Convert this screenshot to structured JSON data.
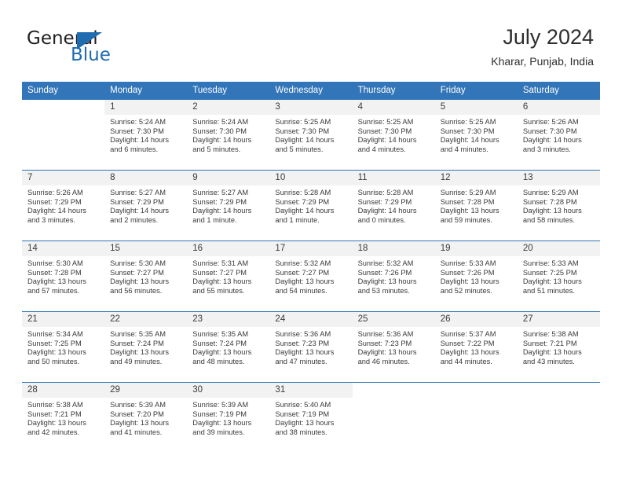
{
  "brand": {
    "name_part1": "General",
    "name_part2": "Blue",
    "logo_icon": "triangle-flag-icon",
    "accent_color": "#1f6cb0"
  },
  "header": {
    "title": "July 2024",
    "location": "Kharar, Punjab, India"
  },
  "calendar": {
    "header_bg": "#3275b9",
    "weekday_headers": [
      "Sunday",
      "Monday",
      "Tuesday",
      "Wednesday",
      "Thursday",
      "Friday",
      "Saturday"
    ],
    "weeks": [
      [
        {
          "day": "",
          "sunrise": "",
          "sunset": "",
          "daylight1": "",
          "daylight2": ""
        },
        {
          "day": "1",
          "sunrise": "Sunrise: 5:24 AM",
          "sunset": "Sunset: 7:30 PM",
          "daylight1": "Daylight: 14 hours",
          "daylight2": "and 6 minutes."
        },
        {
          "day": "2",
          "sunrise": "Sunrise: 5:24 AM",
          "sunset": "Sunset: 7:30 PM",
          "daylight1": "Daylight: 14 hours",
          "daylight2": "and 5 minutes."
        },
        {
          "day": "3",
          "sunrise": "Sunrise: 5:25 AM",
          "sunset": "Sunset: 7:30 PM",
          "daylight1": "Daylight: 14 hours",
          "daylight2": "and 5 minutes."
        },
        {
          "day": "4",
          "sunrise": "Sunrise: 5:25 AM",
          "sunset": "Sunset: 7:30 PM",
          "daylight1": "Daylight: 14 hours",
          "daylight2": "and 4 minutes."
        },
        {
          "day": "5",
          "sunrise": "Sunrise: 5:25 AM",
          "sunset": "Sunset: 7:30 PM",
          "daylight1": "Daylight: 14 hours",
          "daylight2": "and 4 minutes."
        },
        {
          "day": "6",
          "sunrise": "Sunrise: 5:26 AM",
          "sunset": "Sunset: 7:30 PM",
          "daylight1": "Daylight: 14 hours",
          "daylight2": "and 3 minutes."
        }
      ],
      [
        {
          "day": "7",
          "sunrise": "Sunrise: 5:26 AM",
          "sunset": "Sunset: 7:29 PM",
          "daylight1": "Daylight: 14 hours",
          "daylight2": "and 3 minutes."
        },
        {
          "day": "8",
          "sunrise": "Sunrise: 5:27 AM",
          "sunset": "Sunset: 7:29 PM",
          "daylight1": "Daylight: 14 hours",
          "daylight2": "and 2 minutes."
        },
        {
          "day": "9",
          "sunrise": "Sunrise: 5:27 AM",
          "sunset": "Sunset: 7:29 PM",
          "daylight1": "Daylight: 14 hours",
          "daylight2": "and 1 minute."
        },
        {
          "day": "10",
          "sunrise": "Sunrise: 5:28 AM",
          "sunset": "Sunset: 7:29 PM",
          "daylight1": "Daylight: 14 hours",
          "daylight2": "and 1 minute."
        },
        {
          "day": "11",
          "sunrise": "Sunrise: 5:28 AM",
          "sunset": "Sunset: 7:29 PM",
          "daylight1": "Daylight: 14 hours",
          "daylight2": "and 0 minutes."
        },
        {
          "day": "12",
          "sunrise": "Sunrise: 5:29 AM",
          "sunset": "Sunset: 7:28 PM",
          "daylight1": "Daylight: 13 hours",
          "daylight2": "and 59 minutes."
        },
        {
          "day": "13",
          "sunrise": "Sunrise: 5:29 AM",
          "sunset": "Sunset: 7:28 PM",
          "daylight1": "Daylight: 13 hours",
          "daylight2": "and 58 minutes."
        }
      ],
      [
        {
          "day": "14",
          "sunrise": "Sunrise: 5:30 AM",
          "sunset": "Sunset: 7:28 PM",
          "daylight1": "Daylight: 13 hours",
          "daylight2": "and 57 minutes."
        },
        {
          "day": "15",
          "sunrise": "Sunrise: 5:30 AM",
          "sunset": "Sunset: 7:27 PM",
          "daylight1": "Daylight: 13 hours",
          "daylight2": "and 56 minutes."
        },
        {
          "day": "16",
          "sunrise": "Sunrise: 5:31 AM",
          "sunset": "Sunset: 7:27 PM",
          "daylight1": "Daylight: 13 hours",
          "daylight2": "and 55 minutes."
        },
        {
          "day": "17",
          "sunrise": "Sunrise: 5:32 AM",
          "sunset": "Sunset: 7:27 PM",
          "daylight1": "Daylight: 13 hours",
          "daylight2": "and 54 minutes."
        },
        {
          "day": "18",
          "sunrise": "Sunrise: 5:32 AM",
          "sunset": "Sunset: 7:26 PM",
          "daylight1": "Daylight: 13 hours",
          "daylight2": "and 53 minutes."
        },
        {
          "day": "19",
          "sunrise": "Sunrise: 5:33 AM",
          "sunset": "Sunset: 7:26 PM",
          "daylight1": "Daylight: 13 hours",
          "daylight2": "and 52 minutes."
        },
        {
          "day": "20",
          "sunrise": "Sunrise: 5:33 AM",
          "sunset": "Sunset: 7:25 PM",
          "daylight1": "Daylight: 13 hours",
          "daylight2": "and 51 minutes."
        }
      ],
      [
        {
          "day": "21",
          "sunrise": "Sunrise: 5:34 AM",
          "sunset": "Sunset: 7:25 PM",
          "daylight1": "Daylight: 13 hours",
          "daylight2": "and 50 minutes."
        },
        {
          "day": "22",
          "sunrise": "Sunrise: 5:35 AM",
          "sunset": "Sunset: 7:24 PM",
          "daylight1": "Daylight: 13 hours",
          "daylight2": "and 49 minutes."
        },
        {
          "day": "23",
          "sunrise": "Sunrise: 5:35 AM",
          "sunset": "Sunset: 7:24 PM",
          "daylight1": "Daylight: 13 hours",
          "daylight2": "and 48 minutes."
        },
        {
          "day": "24",
          "sunrise": "Sunrise: 5:36 AM",
          "sunset": "Sunset: 7:23 PM",
          "daylight1": "Daylight: 13 hours",
          "daylight2": "and 47 minutes."
        },
        {
          "day": "25",
          "sunrise": "Sunrise: 5:36 AM",
          "sunset": "Sunset: 7:23 PM",
          "daylight1": "Daylight: 13 hours",
          "daylight2": "and 46 minutes."
        },
        {
          "day": "26",
          "sunrise": "Sunrise: 5:37 AM",
          "sunset": "Sunset: 7:22 PM",
          "daylight1": "Daylight: 13 hours",
          "daylight2": "and 44 minutes."
        },
        {
          "day": "27",
          "sunrise": "Sunrise: 5:38 AM",
          "sunset": "Sunset: 7:21 PM",
          "daylight1": "Daylight: 13 hours",
          "daylight2": "and 43 minutes."
        }
      ],
      [
        {
          "day": "28",
          "sunrise": "Sunrise: 5:38 AM",
          "sunset": "Sunset: 7:21 PM",
          "daylight1": "Daylight: 13 hours",
          "daylight2": "and 42 minutes."
        },
        {
          "day": "29",
          "sunrise": "Sunrise: 5:39 AM",
          "sunset": "Sunset: 7:20 PM",
          "daylight1": "Daylight: 13 hours",
          "daylight2": "and 41 minutes."
        },
        {
          "day": "30",
          "sunrise": "Sunrise: 5:39 AM",
          "sunset": "Sunset: 7:19 PM",
          "daylight1": "Daylight: 13 hours",
          "daylight2": "and 39 minutes."
        },
        {
          "day": "31",
          "sunrise": "Sunrise: 5:40 AM",
          "sunset": "Sunset: 7:19 PM",
          "daylight1": "Daylight: 13 hours",
          "daylight2": "and 38 minutes."
        },
        {
          "day": "",
          "sunrise": "",
          "sunset": "",
          "daylight1": "",
          "daylight2": ""
        },
        {
          "day": "",
          "sunrise": "",
          "sunset": "",
          "daylight1": "",
          "daylight2": ""
        },
        {
          "day": "",
          "sunrise": "",
          "sunset": "",
          "daylight1": "",
          "daylight2": ""
        }
      ]
    ]
  }
}
